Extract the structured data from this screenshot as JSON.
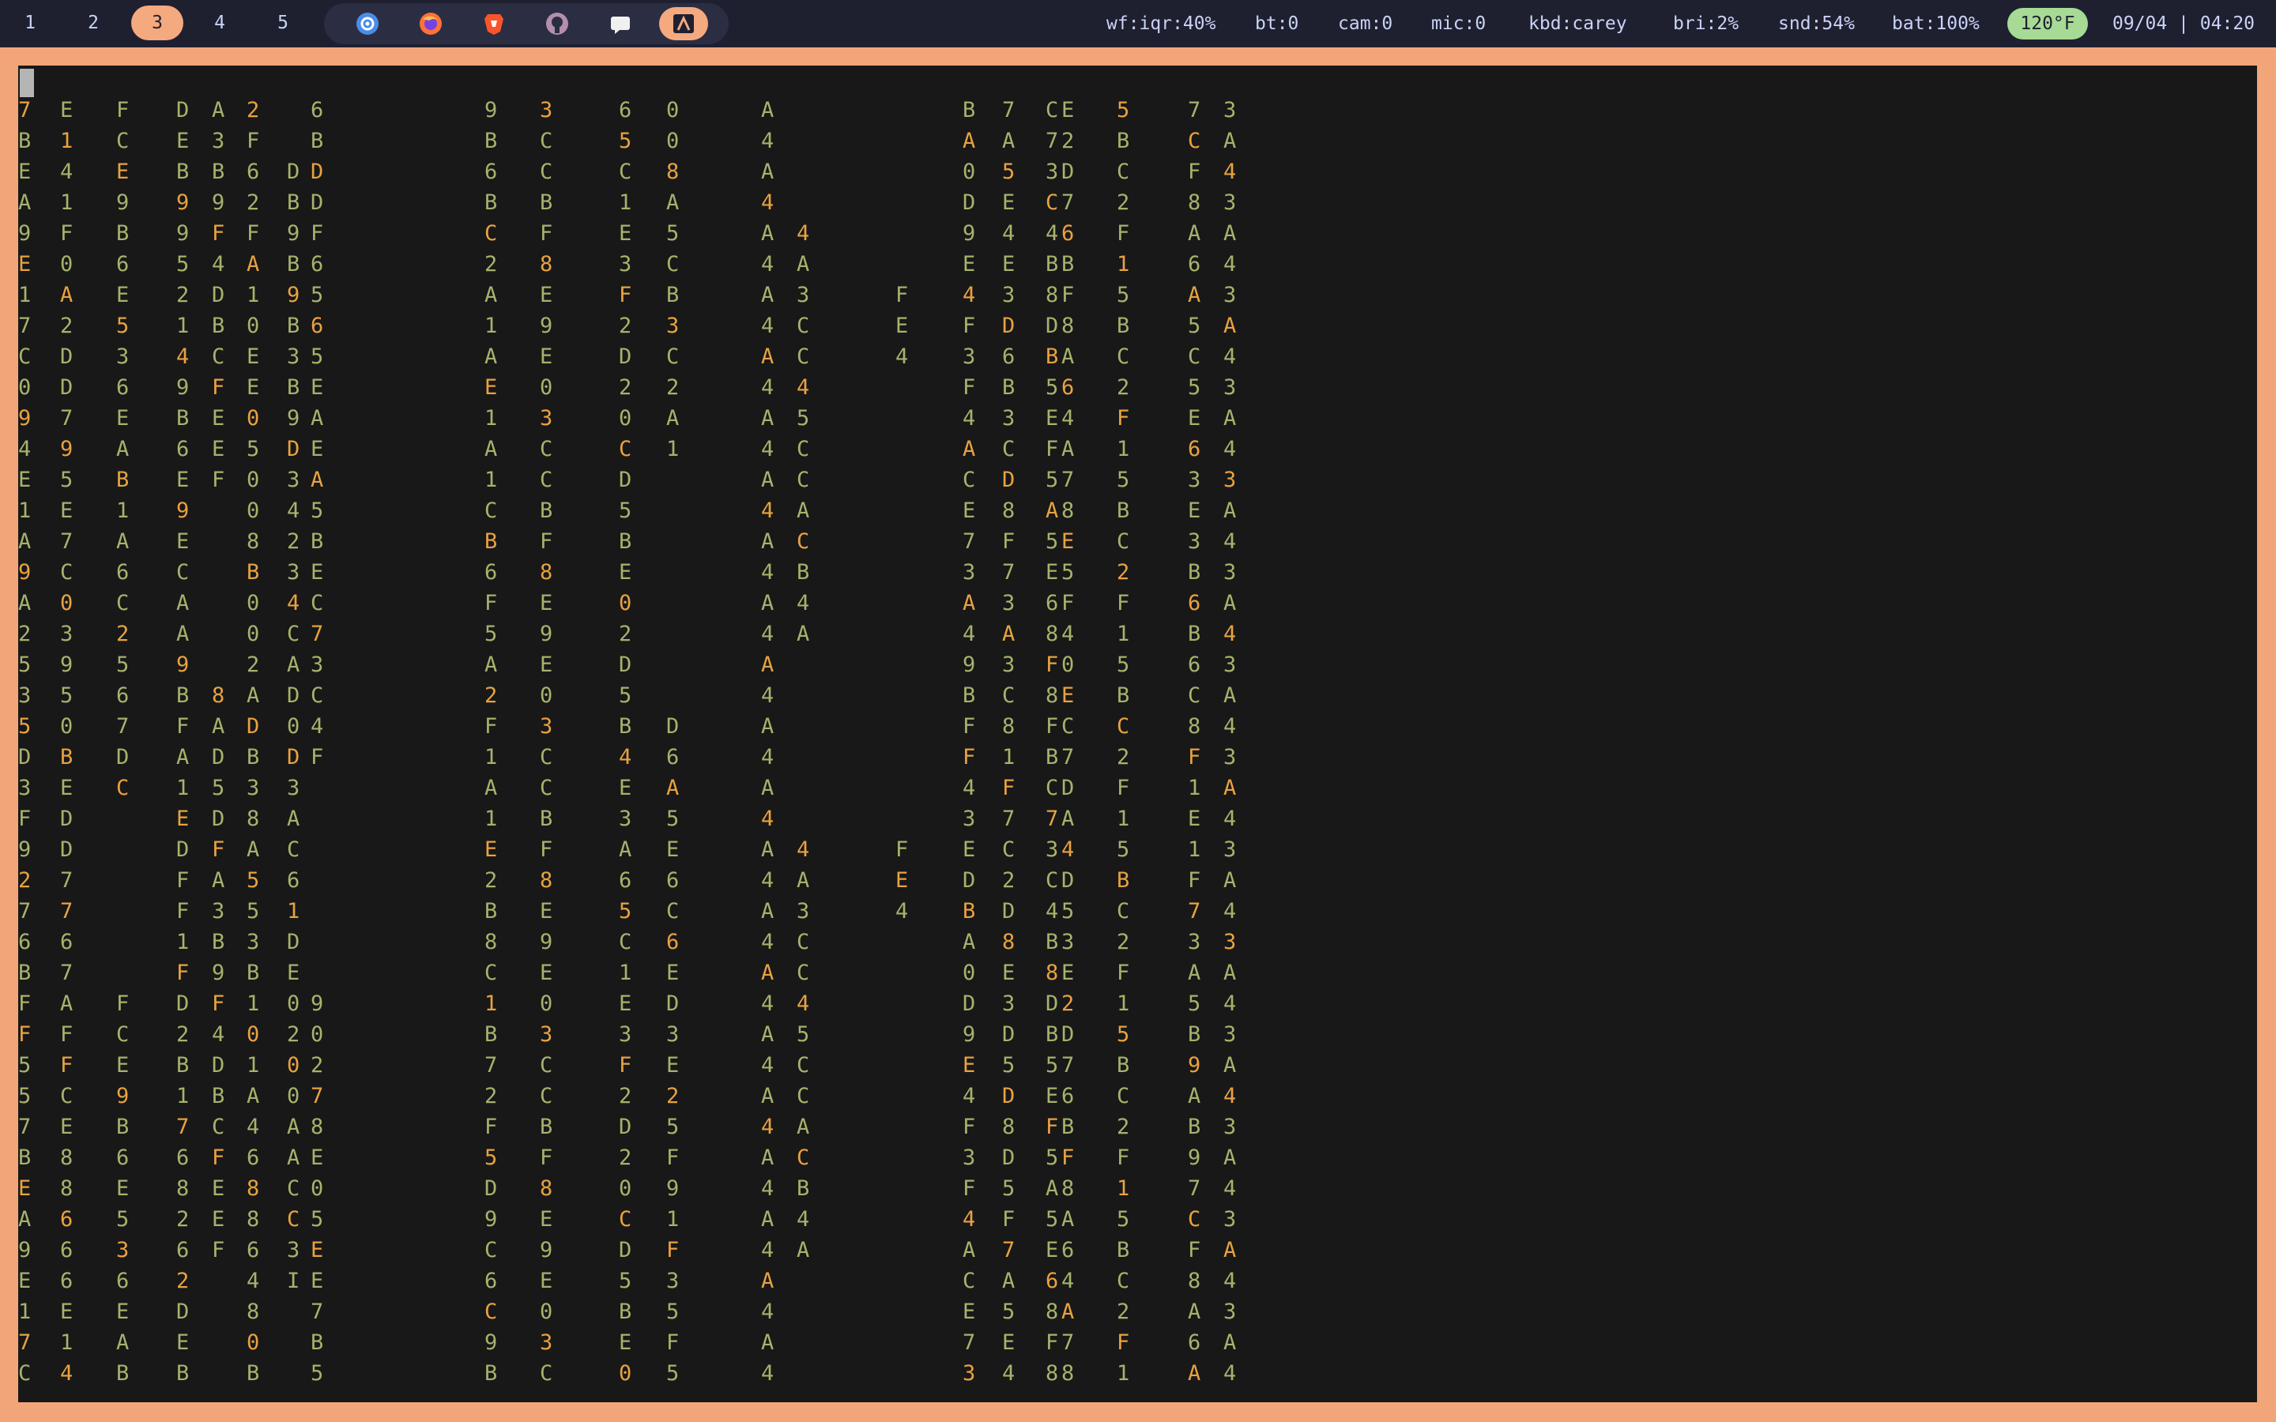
{
  "topbar": {
    "workspaces": [
      {
        "label": "1",
        "active": false
      },
      {
        "label": "2",
        "active": false
      },
      {
        "label": "3",
        "active": true
      },
      {
        "label": "4",
        "active": false
      },
      {
        "label": "5",
        "active": false
      }
    ],
    "apps": [
      {
        "icon": "settings-gear-icon"
      },
      {
        "icon": "firefox-icon"
      },
      {
        "icon": "brave-icon"
      },
      {
        "icon": "github-icon"
      },
      {
        "icon": "chat-bubble-icon"
      },
      {
        "icon": "terminal-icon",
        "active": true
      }
    ],
    "status": {
      "wifi": "wf:iqr:40%",
      "bluetooth": "bt:0",
      "camera": "cam:0",
      "mic": "mic:0",
      "keyboard": "kbd:carey",
      "brightness": "bri:2%",
      "sound": "snd:54%",
      "battery": "bat:100%",
      "temperature": "120°F",
      "datetime": "09/04 | 04:20"
    },
    "colors": {
      "bar_bg": "#1e2030",
      "accent": "#f5a97f",
      "temp_badge": "#a6da95",
      "text": "#cad3f5"
    }
  },
  "terminal": {
    "colors": {
      "bg": "#181818",
      "frame": "#f3a57a",
      "green": "#a7b26c",
      "orange": "#e8a240"
    },
    "columns": [
      "7BEA9E17C094E1A9A2535D3F9276BFF55",
      "666E141F0A2DD795E7C03950BEDD7767AFFCE88",
      "      FCE9B6E536EAB1A6C2567DC",
      "2B1768262DEB9952149B6E9ECAA9BFA1EDFF1FD",
      "      8AD5DFA3B9F4DBCFEEF",
      "01A46886480B4D32F62FA10EE05008B002ADB38A553B1",
      "                    DB9B9B3B9D34234CAD0D3AC61DE0200AACC3I",
      "       90278E05EE7B5B6BDDF6565EAEA5BEC73C4F",
      "              ",
      "CB6F5A2F1A1E2B8C1B72F5D9C6C9B6BC2A1AE1A1",
      "3CCBF8E9E0",
      "2D5B4E3A65C1E3F2D20CD5BE0",
      "        D6A5E6C6ED3E25F91F35F5C8E000008A5CB3C2A1",
      "4A",
      "      4A3CC45CCACB4A",
      "               FE4",
      "9E4F3F4ACE73A49BFF43EDBA0D",
      "7C2D8E3D5D8D5F7A5E4E3D6B3CD8F73A3C81F",
      "5A5E68F8FBC73C4B8DB5EF",
      "3E2D76BF8A64A78E5F40EC7DA4D5",
      "5BC2F1",
      "5C5E63E3B6B6C8F1E1F73A5B9AB97CF8A6A",
      "3A4"
    ]
  }
}
